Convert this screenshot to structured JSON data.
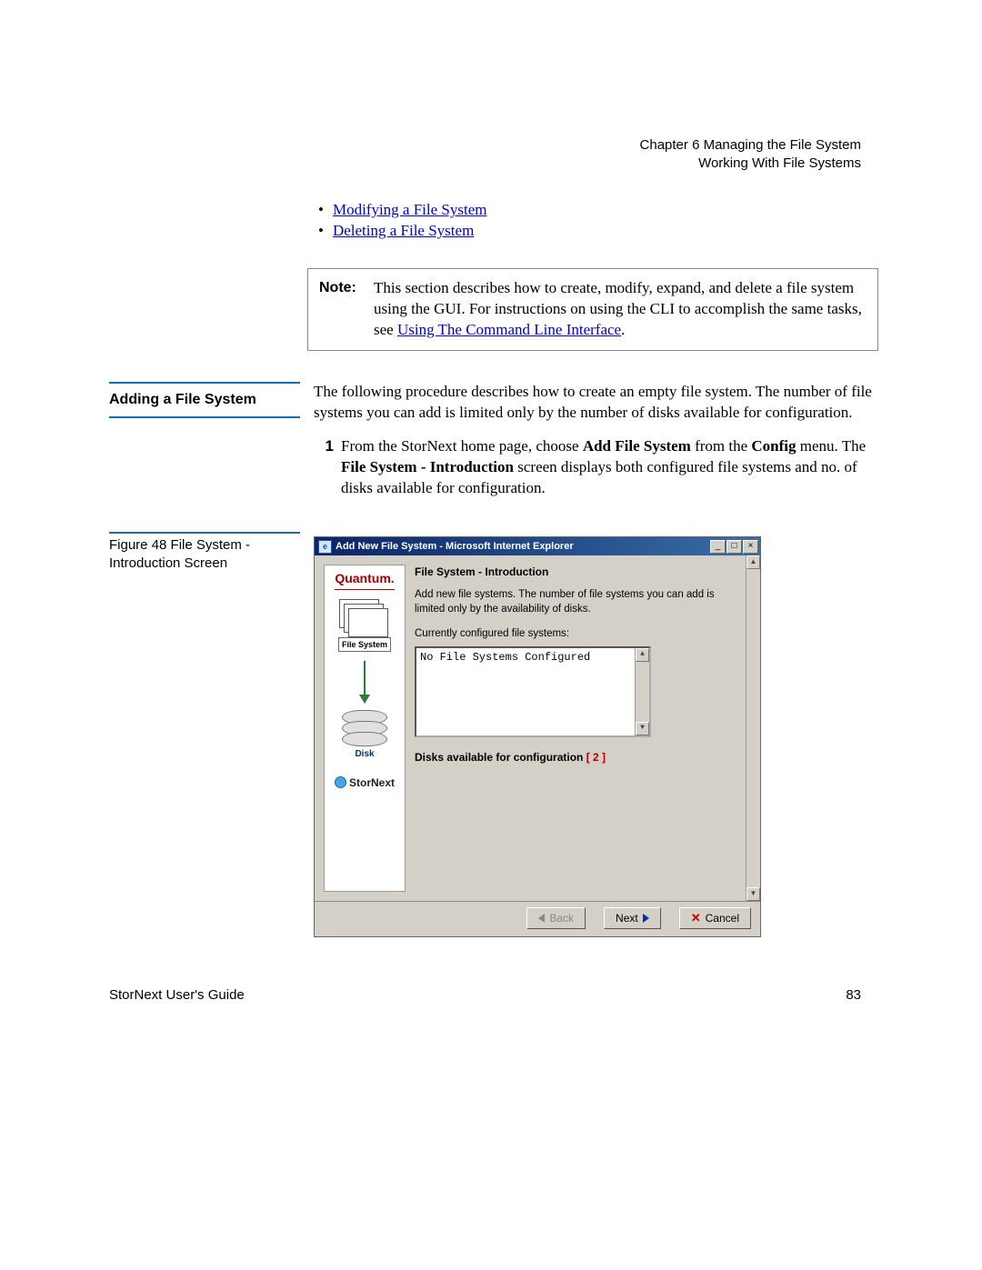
{
  "header": {
    "chapter": "Chapter 6  Managing the File System",
    "section": "Working With File Systems"
  },
  "linklist": {
    "item1": "Modifying a File System",
    "item2": "Deleting a File System"
  },
  "note": {
    "label": "Note:",
    "text_pre": "This section describes how to create, modify, expand, and delete a file system using the GUI. For instructions on using the CLI to accomplish the same tasks, see ",
    "link": "Using The Command Line Interface",
    "text_post": "."
  },
  "heading": "Adding a File System",
  "intro": "The following procedure describes how to create an empty file system. The number of file systems you can add is limited only by the number of disks available for configuration.",
  "step1": {
    "num": "1",
    "pre": "From the StorNext home page, choose ",
    "b1": "Add File System",
    "mid1": " from the ",
    "b2": "Config",
    "mid2": " menu. The ",
    "b3": "File System - Introduction",
    "post": " screen displays both configured file systems and no. of disks available for configuration."
  },
  "figure_caption": "Figure 48  File System - Introduction Screen",
  "ie": {
    "title": "Add New File System - Microsoft Internet Explorer",
    "sidebar": {
      "brand": "Quantum.",
      "fs_label": "File System",
      "disk_label": "Disk",
      "sn": "StorNext"
    },
    "content": {
      "title": "File System - Introduction",
      "para": "Add new file systems. The number of file systems you can add is limited only by the availability of disks.",
      "list_label": "Currently configured file systems:",
      "list_value": "No File Systems Configured",
      "disks_label_pre": "Disks available for configuration ",
      "disks_count": "[ 2 ]"
    },
    "buttons": {
      "back": "Back",
      "next": "Next",
      "cancel": "Cancel"
    }
  },
  "footer": {
    "left": "StorNext User's Guide",
    "right": "83"
  }
}
